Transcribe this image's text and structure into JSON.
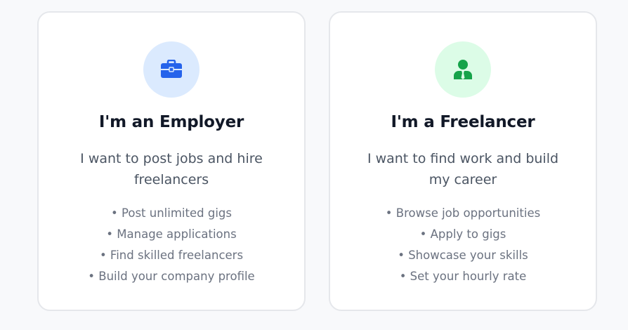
{
  "colors": {
    "employer_accent": "#2563eb",
    "employer_bg": "#dbeafe",
    "freelancer_accent": "#16a34a",
    "freelancer_bg": "#dcfce7"
  },
  "employer": {
    "icon": "briefcase-icon",
    "title": "I'm an Employer",
    "description": "I want to post jobs and hire freelancers",
    "features": [
      "• Post unlimited gigs",
      "• Manage applications",
      "• Find skilled freelancers",
      "• Build your company profile"
    ]
  },
  "freelancer": {
    "icon": "user-tie-icon",
    "title": "I'm a Freelancer",
    "description": "I want to find work and build my career",
    "features": [
      "• Browse job opportunities",
      "• Apply to gigs",
      "• Showcase your skills",
      "• Set your hourly rate"
    ]
  }
}
